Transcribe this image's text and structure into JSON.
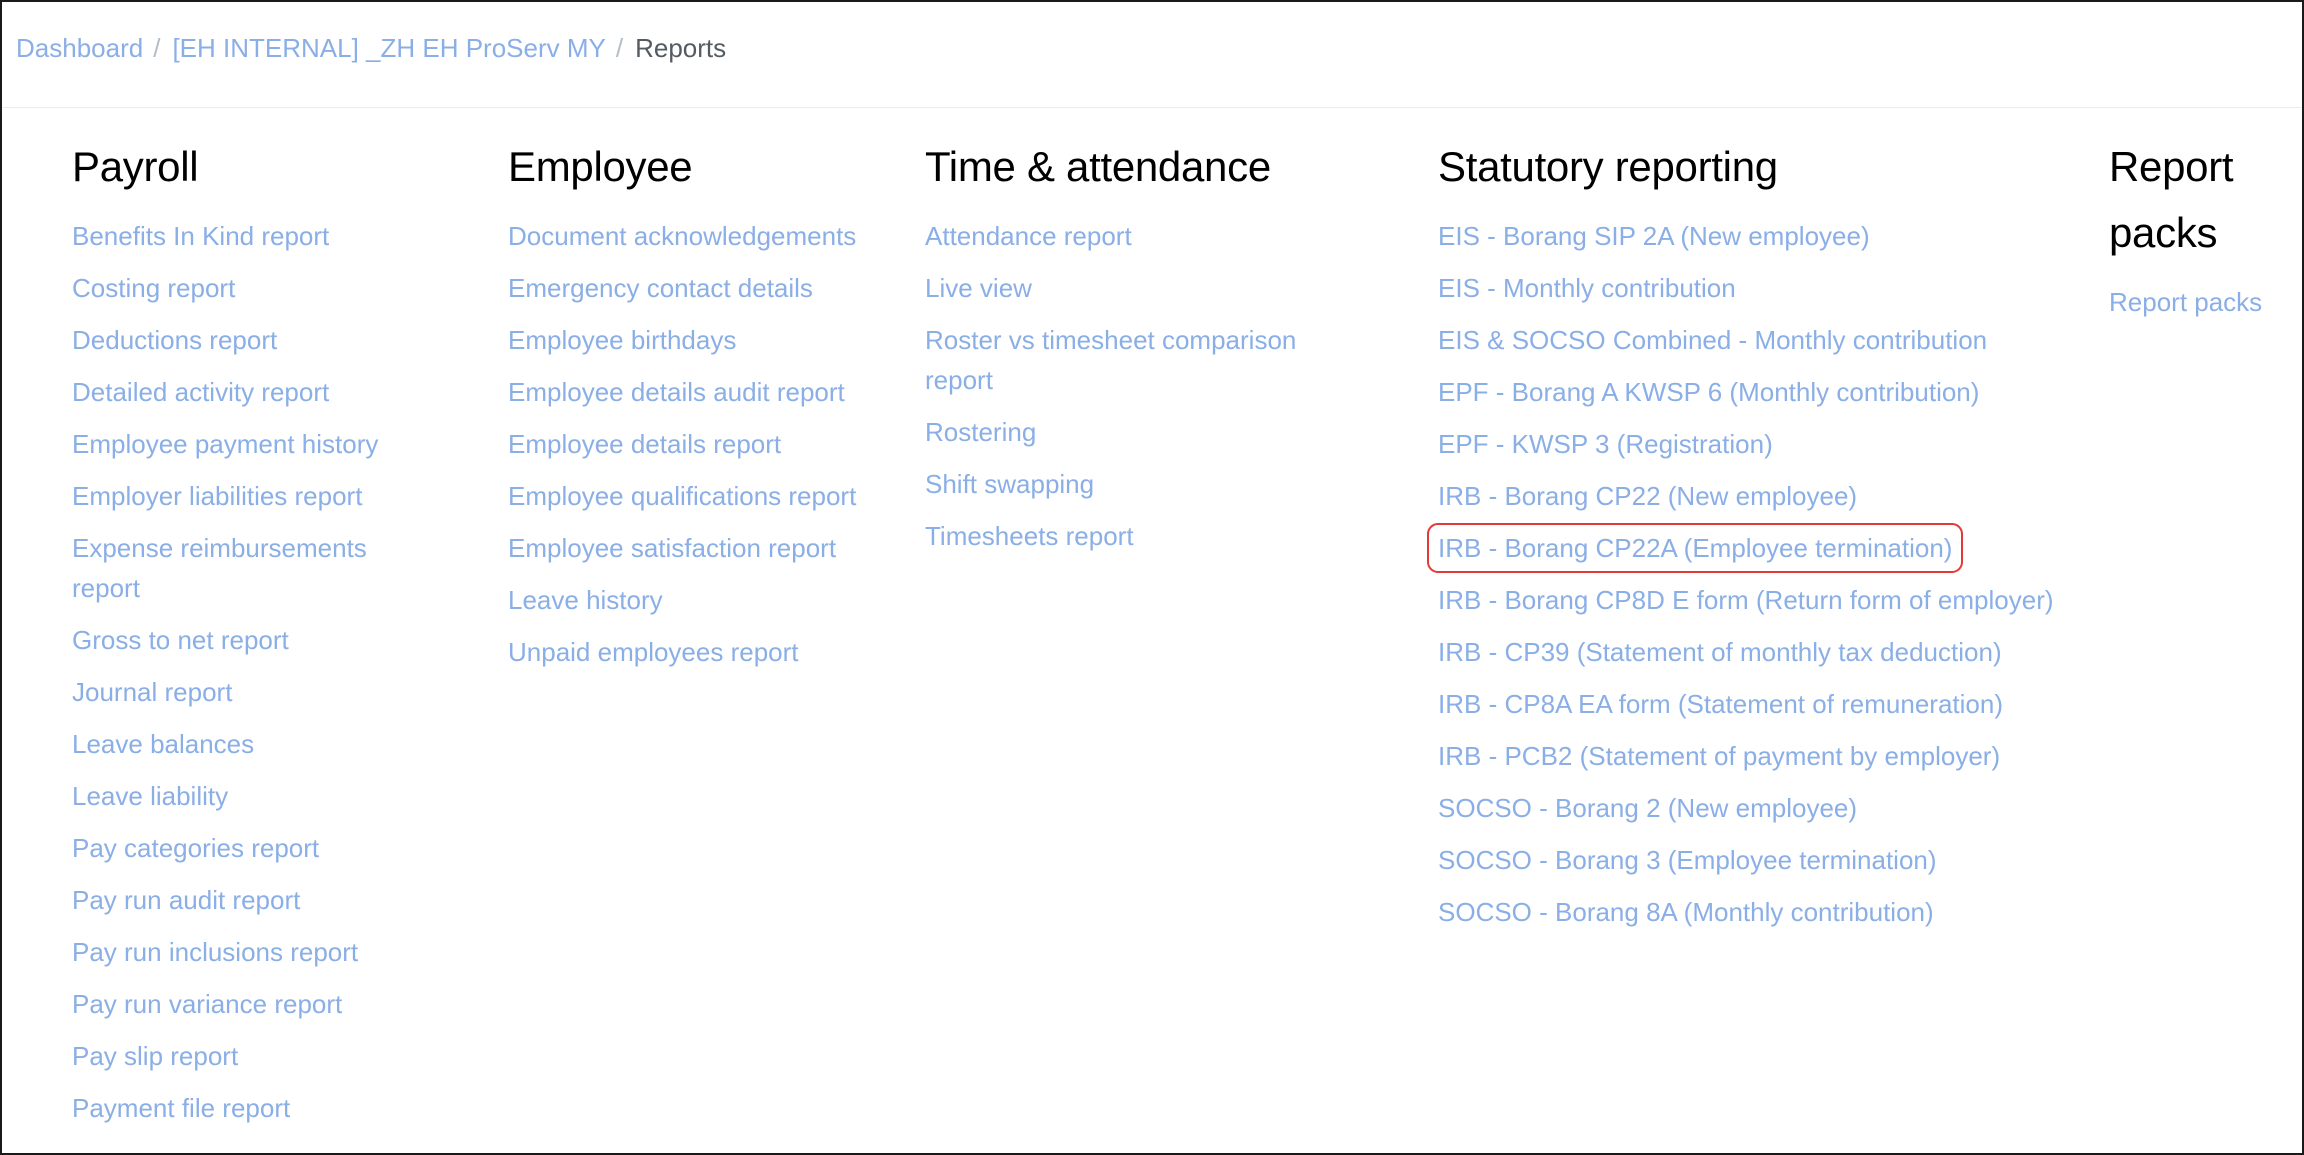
{
  "breadcrumb": {
    "items": [
      {
        "label": "Dashboard"
      },
      {
        "label": "[EH INTERNAL] _ZH EH ProServ MY"
      }
    ],
    "separator": "/",
    "current": "Reports"
  },
  "colors": {
    "link": "#8aaee6",
    "heading": "#000000",
    "highlight_border": "#e53935"
  },
  "columns": {
    "payroll": {
      "title": "Payroll",
      "links": [
        "Benefits In Kind report",
        "Costing report",
        "Deductions report",
        "Detailed activity report",
        "Employee payment history",
        "Employer liabilities report",
        "Expense reimbursements report",
        "Gross to net report",
        "Journal report",
        "Leave balances",
        "Leave liability",
        "Pay categories report",
        "Pay run audit report",
        "Pay run inclusions report",
        "Pay run variance report",
        "Pay slip report",
        "Payment file report"
      ]
    },
    "employee": {
      "title": "Employee",
      "links": [
        "Document acknowledgements",
        "Emergency contact details",
        "Employee birthdays",
        "Employee details audit report",
        "Employee details report",
        "Employee qualifications report",
        "Employee satisfaction report",
        "Leave history",
        "Unpaid employees report"
      ]
    },
    "time": {
      "title": "Time & attendance",
      "links": [
        "Attendance report",
        "Live view",
        "Roster vs timesheet comparison report",
        "Rostering",
        "Shift swapping",
        "Timesheets report"
      ]
    },
    "statutory": {
      "title": "Statutory reporting",
      "links": [
        "EIS - Borang SIP 2A (New employee)",
        "EIS - Monthly contribution",
        "EIS & SOCSO Combined - Monthly contribution",
        "EPF - Borang A KWSP 6 (Monthly contribution)",
        "EPF - KWSP 3 (Registration)",
        "IRB - Borang CP22 (New employee)",
        "IRB - Borang CP22A (Employee termination)",
        "IRB - Borang CP8D E form (Return form of employer)",
        "IRB - CP39 (Statement of monthly tax deduction)",
        "IRB - CP8A EA form (Statement of remuneration)",
        "IRB - PCB2 (Statement of payment by employer)",
        "SOCSO - Borang 2 (New employee)",
        "SOCSO - Borang 3 (Employee termination)",
        "SOCSO - Borang 8A (Monthly contribution)"
      ],
      "highlighted_link": "IRB - Borang CP22A (Employee termination)"
    },
    "packs": {
      "title": "Report packs",
      "links": [
        "Report packs"
      ]
    }
  }
}
